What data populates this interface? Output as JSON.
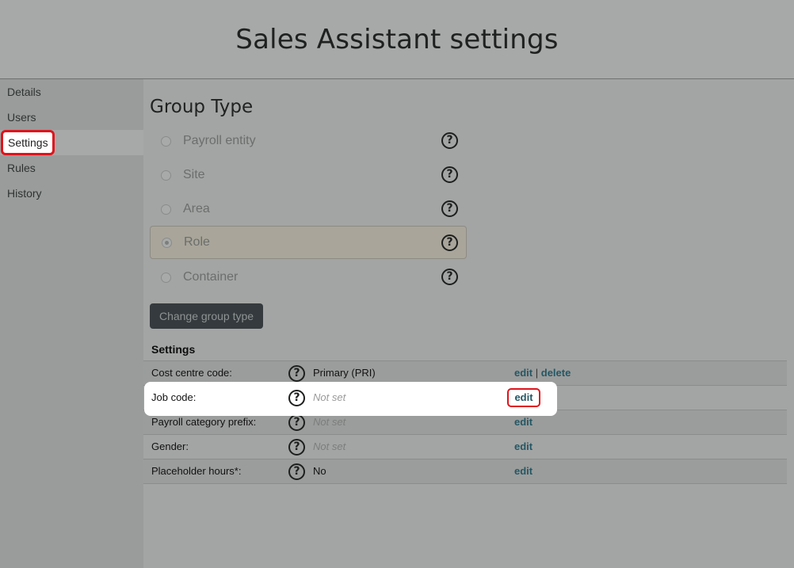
{
  "header": {
    "title": "Sales Assistant settings"
  },
  "sidebar": {
    "items": [
      {
        "label": "Details"
      },
      {
        "label": "Users"
      },
      {
        "label": "Settings"
      },
      {
        "label": "Rules"
      },
      {
        "label": "History"
      }
    ],
    "active": "Settings"
  },
  "group_type": {
    "title": "Group Type",
    "options": [
      {
        "label": "Payroll entity",
        "checked": false
      },
      {
        "label": "Site",
        "checked": false
      },
      {
        "label": "Area",
        "checked": false
      },
      {
        "label": "Role",
        "checked": true
      },
      {
        "label": "Container",
        "checked": false
      }
    ],
    "help_glyph": "?",
    "change_button": "Change group type"
  },
  "settings": {
    "title": "Settings",
    "help_glyph": "?",
    "separator": "|",
    "rows": [
      {
        "label": "Cost centre code:",
        "value": "Primary (PRI)",
        "edit": "edit",
        "delete": "delete"
      },
      {
        "label": "Job code:",
        "value": "Not set",
        "edit": "edit"
      },
      {
        "label": "Payroll category prefix:",
        "value": "Not set",
        "edit": "edit"
      },
      {
        "label": "Gender:",
        "value": "Not set",
        "edit": "edit"
      },
      {
        "label": "Placeholder hours*:",
        "value": "No",
        "edit": "edit"
      }
    ]
  },
  "colors": {
    "highlight_border": "#e0131b",
    "link": "#255764",
    "button_bg": "#343a3d"
  }
}
